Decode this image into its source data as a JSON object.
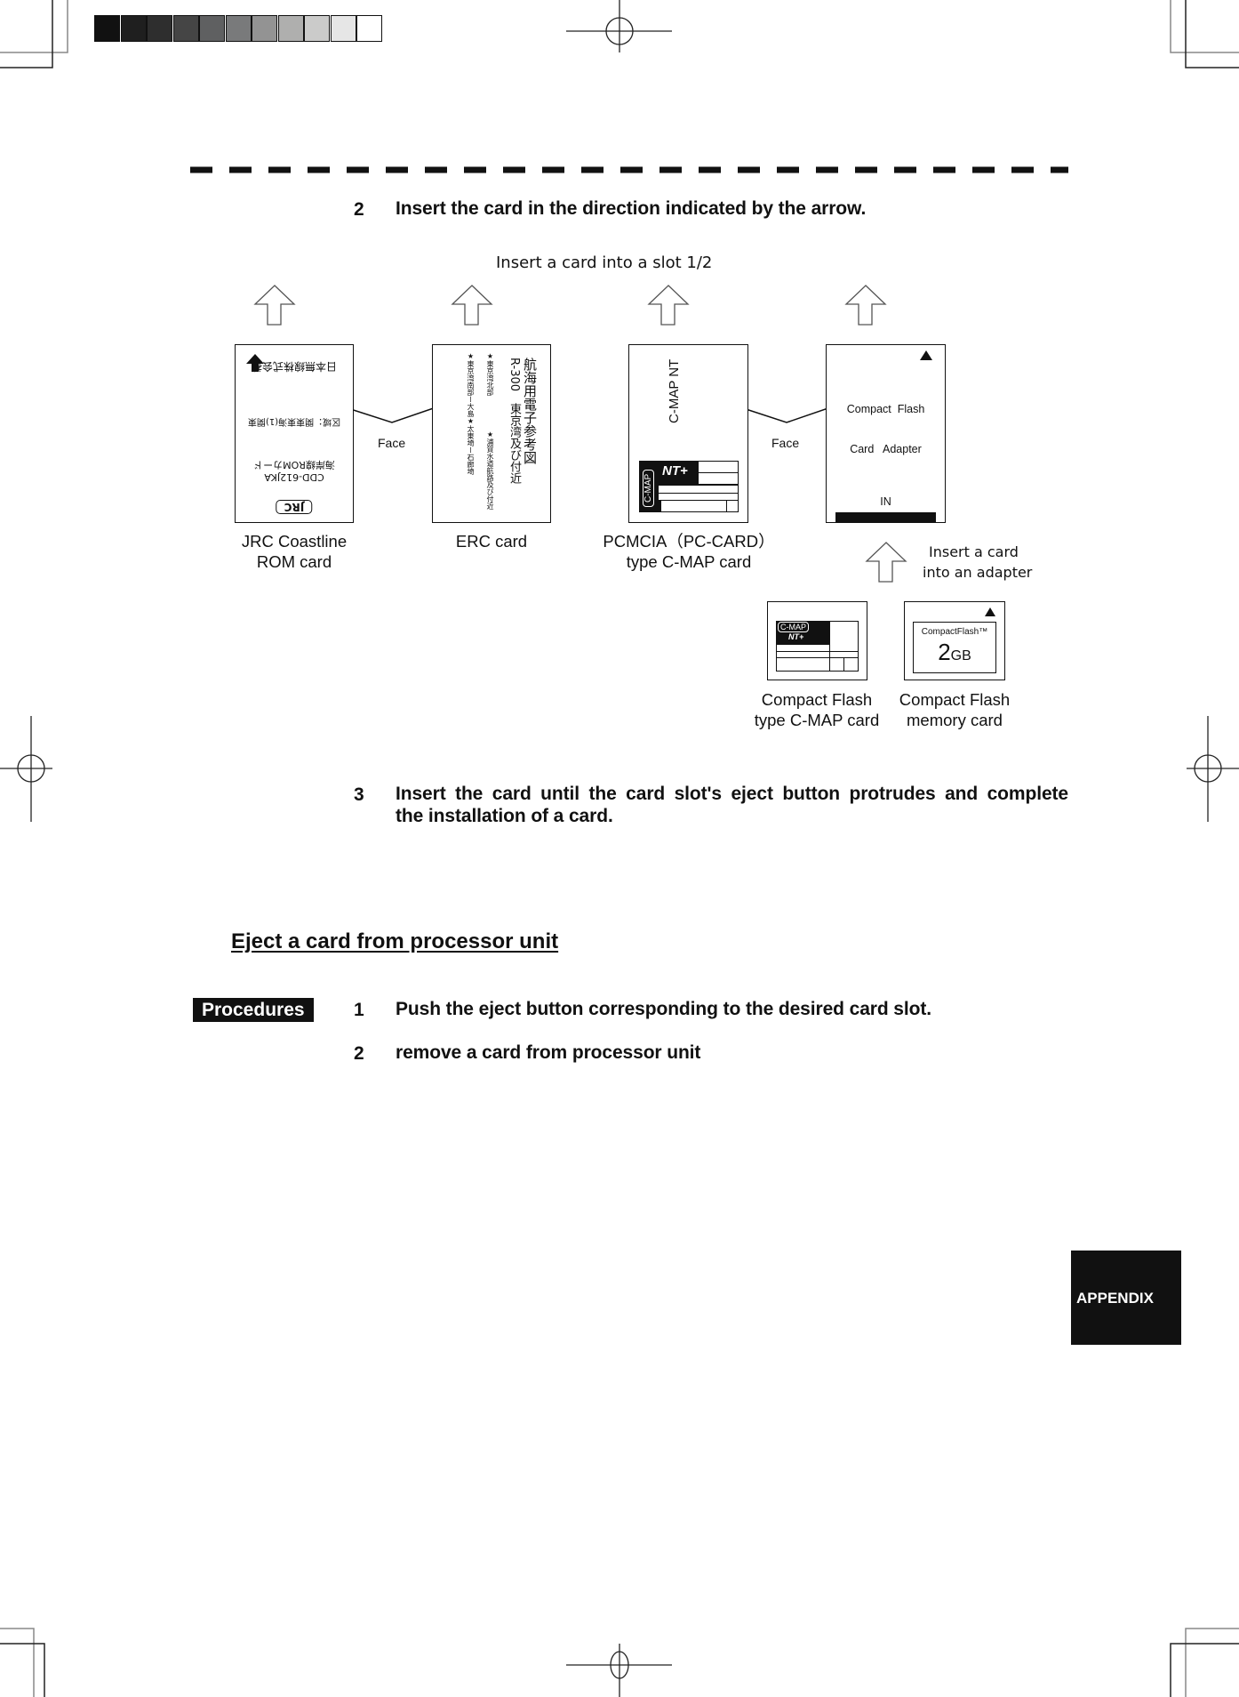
{
  "print_marks": {
    "grayscale_swatches": [
      "#111111",
      "#1f1f1f",
      "#2e2e2e",
      "#454545",
      "#5f6061",
      "#797a7b",
      "#939393",
      "#afafae",
      "#cbcbca",
      "#e6e6e6",
      "#ffffff"
    ]
  },
  "steps_insert": [
    {
      "number": "2",
      "text": "Insert the card in the direction indicated by the arrow."
    },
    {
      "number": "3",
      "text_line1": "Insert the card until the card slot's eject button protrudes and complete",
      "text_line2": "the installation of a card."
    }
  ],
  "figure": {
    "title": "Insert a card into a slot 1/2",
    "face_label": "Face",
    "adapter_insert_label_line1": "Insert a card",
    "adapter_insert_label_line2": "into an adapter",
    "cards": {
      "jrc": {
        "caption_line1": "JRC Coastline",
        "caption_line2": "ROM card",
        "maker": "日本無線株式会社",
        "area": "区域：関東東海(1)関東",
        "type": "海岸線ROMカード",
        "model": "CDD-612JKA",
        "logo": "JRC"
      },
      "erc": {
        "caption": "ERC card",
        "title": "航海用電子参考図",
        "subtitle": "R-300　東京湾及び付近",
        "line1a": "★東京湾北部",
        "line1b": "★浦賀水道航路及び付近",
        "line2": "★東京湾南部ー大島★太東埼ー石廊埼"
      },
      "pcmcia": {
        "caption_line1": "PCMCIA（PC-CARD）",
        "caption_line2": "type C-MAP card",
        "brand_text": "C-MAP NT",
        "label_logo": "C-MAP",
        "label_product": "NT+"
      },
      "adapter": {
        "line1": "Compact  Flash",
        "line2": "Card   Adapter",
        "slot_label": "IN"
      },
      "cf_cmap": {
        "caption_line1": "Compact Flash",
        "caption_line2": "type C-MAP card",
        "label_logo": "C-MAP",
        "label_product": "NT+"
      },
      "cf_memory": {
        "caption_line1": "Compact Flash",
        "caption_line2": "memory card",
        "brand": "CompactFlash™",
        "capacity_number": "2",
        "capacity_unit": "GB"
      }
    }
  },
  "eject_section": {
    "heading": "Eject a card from processor unit",
    "badge": "Procedures",
    "steps": [
      {
        "number": "1",
        "text": "Push the eject button corresponding to the desired card slot."
      },
      {
        "number": "2",
        "text": "remove a card from processor unit"
      }
    ]
  },
  "side_tab": {
    "label": "APPENDIX"
  }
}
